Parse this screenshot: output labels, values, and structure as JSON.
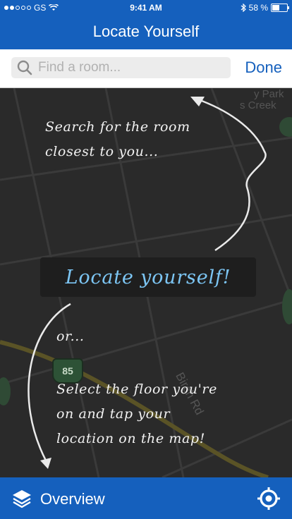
{
  "status": {
    "carrier": "GS",
    "time": "9:41 AM",
    "battery": "58 %",
    "battery_level": 0.58
  },
  "nav": {
    "title": "Locate Yourself"
  },
  "search": {
    "placeholder": "Find a room...",
    "done_label": "Done"
  },
  "map": {
    "hint_top_line1": "Search for the room",
    "hint_top_line2": "closest to you...",
    "locate_label": "Locate yourself!",
    "or_label": "or...",
    "hint_bottom_line1": "Select the floor you're",
    "hint_bottom_line2": "on and tap your",
    "hint_bottom_line3": "location on the map!",
    "road_label": "Birch Rd",
    "shield_number": "85",
    "park_label": "y Park",
    "creek_label": "s Creek"
  },
  "bottom": {
    "overview_label": "Overview"
  },
  "colors": {
    "brand": "#1560bd",
    "accent_text": "#7cc5f3"
  }
}
